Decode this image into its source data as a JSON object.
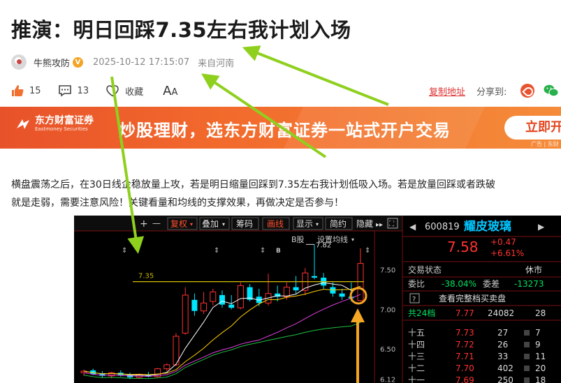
{
  "article": {
    "title": "推演：明日回踩7.35左右我计划入场",
    "author": "牛熊攻防",
    "verified": "V",
    "time": "2025-10-12 17:15:07",
    "location": "来自河南",
    "likes": "15",
    "comments": "13",
    "favorite": "收藏",
    "font_a_big": "A",
    "font_a_small": "A",
    "copy_link": "复制地址",
    "share_to": "分享到:",
    "line1": "横盘震荡之后，在30日线企稳放量上攻，若是明日缩量回踩到7.35左右我计划低吸入场。若是放量回踩或者跌破",
    "line2": "就是走弱，需要注意风险！关键看量和均线的支撑效果，再做决定是否参与！"
  },
  "banner": {
    "brand_cn": "东方财富证券",
    "brand_en": "Eastmoney Securities",
    "slogan": "炒股理财，选东方财富证券一站式开户交易",
    "cta": "立即开",
    "ad_tag": "广告 | 东财"
  },
  "toolbar": {
    "plus": "+",
    "minus": "—",
    "fuquan": "复权",
    "diejia": "叠加",
    "chouma": "筹码",
    "huaxian": "画线",
    "xianshi": "显示",
    "jianyue": "简约",
    "yincang": "隐藏",
    "arrows": "▸▸"
  },
  "chart_labels": {
    "b_share": "B股",
    "ma_settings": "设置均线",
    "high_mark": "7.82",
    "line_level": "7.35",
    "y_750": "7.50",
    "y_700": "7.00",
    "y_650": "6.50",
    "y_612": "6.12"
  },
  "quote": {
    "code": "600819",
    "name": "耀皮玻璃",
    "price": "7.58",
    "change": "+0.47",
    "change_pct": "+6.61%",
    "status_label": "交易状态",
    "status_value": "休市",
    "weibi_label": "委比",
    "weibi_value": "-38.04%",
    "weicha_label": "委差",
    "weicha_value": "-13273",
    "q_mark": "?",
    "full_book": "查看完整档买卖盘",
    "total_label": "共24档",
    "total_price": "7.77",
    "total_vol": "24082",
    "total_extra": "28"
  },
  "order_book": [
    {
      "level": "十五",
      "price": "7.73",
      "vol": "27",
      "extra": "7"
    },
    {
      "level": "十四",
      "price": "7.72",
      "vol": "26",
      "extra": "9"
    },
    {
      "level": "十三",
      "price": "7.71",
      "vol": "33",
      "extra": "11"
    },
    {
      "level": "十二",
      "price": "7.70",
      "vol": "402",
      "extra": "20"
    },
    {
      "level": "十一",
      "price": "7.69",
      "vol": "250",
      "extra": "18"
    }
  ],
  "colors": {
    "up_red": "#ff3232",
    "down_cyan": "#00e5ff",
    "annotation_green": "#8fd01e",
    "annotation_orange": "#f5a623",
    "banner_orange": "#f26a2c"
  },
  "candles": [
    {
      "o": 6.2,
      "h": 6.24,
      "l": 6.16,
      "c": 6.22
    },
    {
      "o": 6.23,
      "h": 6.25,
      "l": 6.17,
      "c": 6.18
    },
    {
      "o": 6.19,
      "h": 6.22,
      "l": 6.14,
      "c": 6.16
    },
    {
      "o": 6.16,
      "h": 6.21,
      "l": 6.13,
      "c": 6.2
    },
    {
      "o": 6.2,
      "h": 6.23,
      "l": 6.15,
      "c": 6.17
    },
    {
      "o": 6.17,
      "h": 6.2,
      "l": 6.12,
      "c": 6.14
    },
    {
      "o": 6.14,
      "h": 6.19,
      "l": 6.12,
      "c": 6.18
    },
    {
      "o": 6.18,
      "h": 6.21,
      "l": 6.14,
      "c": 6.15
    },
    {
      "o": 6.15,
      "h": 6.26,
      "l": 6.14,
      "c": 6.25
    },
    {
      "o": 6.25,
      "h": 6.32,
      "l": 6.22,
      "c": 6.3
    },
    {
      "o": 6.3,
      "h": 6.7,
      "l": 6.28,
      "c": 6.66
    },
    {
      "o": 6.7,
      "h": 7.28,
      "l": 6.68,
      "c": 7.18
    },
    {
      "o": 7.12,
      "h": 7.2,
      "l": 6.92,
      "c": 6.98
    },
    {
      "o": 6.98,
      "h": 7.22,
      "l": 6.94,
      "c": 7.08
    },
    {
      "o": 7.1,
      "h": 7.26,
      "l": 7.05,
      "c": 7.22
    },
    {
      "o": 7.18,
      "h": 7.24,
      "l": 7.02,
      "c": 7.06
    },
    {
      "o": 7.06,
      "h": 7.18,
      "l": 7.0,
      "c": 7.02
    },
    {
      "o": 7.02,
      "h": 7.34,
      "l": 7.0,
      "c": 7.3
    },
    {
      "o": 7.28,
      "h": 7.32,
      "l": 7.1,
      "c": 7.12
    },
    {
      "o": 7.16,
      "h": 7.26,
      "l": 7.04,
      "c": 7.08
    },
    {
      "o": 7.08,
      "h": 7.45,
      "l": 7.05,
      "c": 7.2
    },
    {
      "o": 7.2,
      "h": 7.3,
      "l": 7.1,
      "c": 7.16
    },
    {
      "o": 7.16,
      "h": 7.34,
      "l": 7.12,
      "c": 7.28
    },
    {
      "o": 7.28,
      "h": 7.42,
      "l": 7.2,
      "c": 7.24
    },
    {
      "o": 7.24,
      "h": 7.52,
      "l": 7.18,
      "c": 7.46
    },
    {
      "o": 7.42,
      "h": 7.82,
      "l": 7.38,
      "c": 7.4
    },
    {
      "o": 7.4,
      "h": 7.46,
      "l": 7.26,
      "c": 7.3
    },
    {
      "o": 7.28,
      "h": 7.34,
      "l": 7.16,
      "c": 7.2
    },
    {
      "o": 7.2,
      "h": 7.26,
      "l": 7.12,
      "c": 7.16
    },
    {
      "o": 7.16,
      "h": 7.34,
      "l": 7.1,
      "c": 7.14
    },
    {
      "o": 7.11,
      "h": 7.77,
      "l": 7.1,
      "c": 7.58
    }
  ]
}
